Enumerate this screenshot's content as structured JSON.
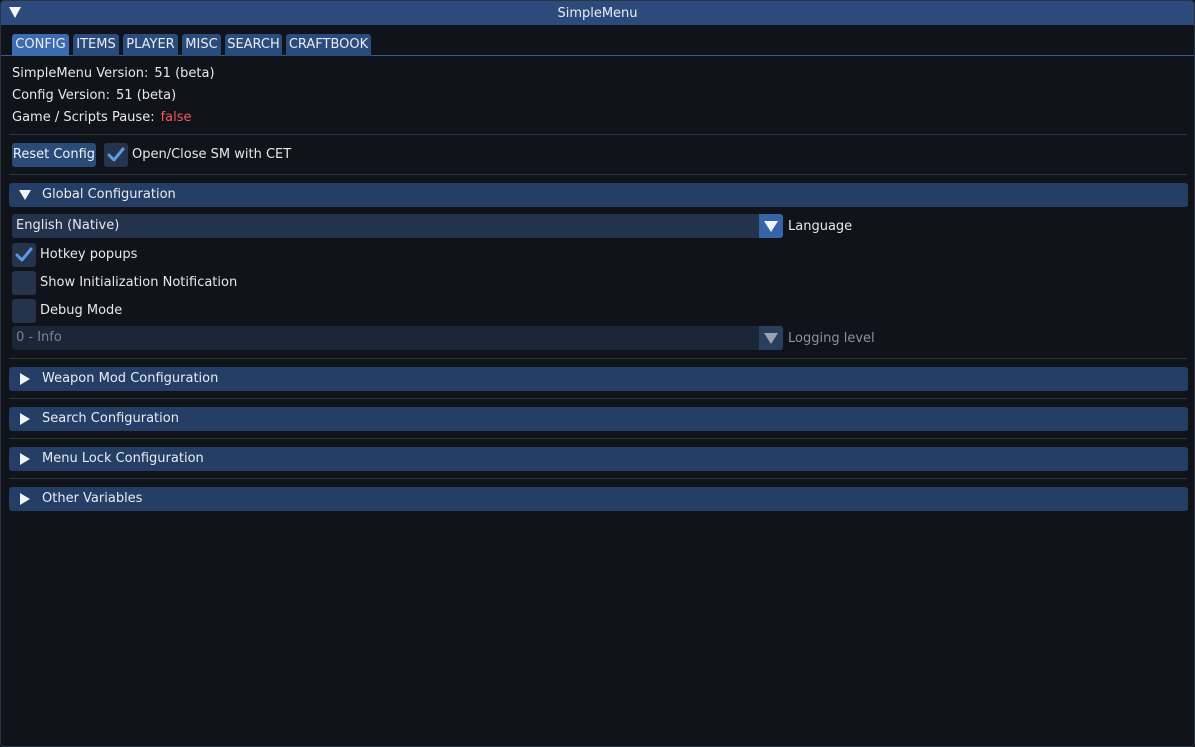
{
  "window": {
    "title": "SimpleMenu"
  },
  "tabs": [
    {
      "label": "CONFIG",
      "active": true
    },
    {
      "label": "ITEMS"
    },
    {
      "label": "PLAYER"
    },
    {
      "label": "MISC"
    },
    {
      "label": "SEARCH"
    },
    {
      "label": "CRAFTBOOK"
    }
  ],
  "info": {
    "sm_version_label": "SimpleMenu Version:",
    "sm_version_value": "51 (beta)",
    "config_version_label": "Config Version:",
    "config_version_value": "51 (beta)",
    "pause_label": "Game / Scripts Pause:",
    "pause_value": "false"
  },
  "actions": {
    "reset_label": "Reset Config",
    "open_close_label": "Open/Close SM with CET",
    "open_close_checked": true
  },
  "global_config": {
    "header": "Global Configuration",
    "language_value": "English (Native)",
    "language_label": "Language",
    "hotkey_label": "Hotkey popups",
    "hotkey_checked": true,
    "init_notif_label": "Show Initialization Notification",
    "init_notif_checked": false,
    "debug_label": "Debug Mode",
    "debug_checked": false,
    "logging_value": "0 - Info",
    "logging_label": "Logging level"
  },
  "sections": {
    "weapon_mod": "Weapon Mod Configuration",
    "search": "Search Configuration",
    "menu_lock": "Menu Lock Configuration",
    "other_vars": "Other Variables"
  },
  "colors": {
    "accent": "#3d6bb0",
    "false_value": "#ef5b5b"
  }
}
